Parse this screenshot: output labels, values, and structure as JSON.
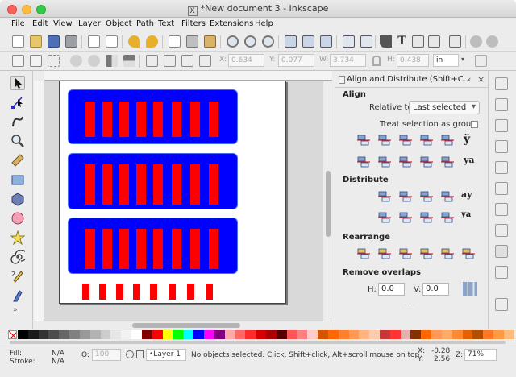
{
  "window": {
    "title": "*New document 3 - Inkscape",
    "app_glyph": "X"
  },
  "menu": [
    "File",
    "Edit",
    "View",
    "Layer",
    "Object",
    "Path",
    "Text",
    "Filters",
    "Extensions",
    "Help"
  ],
  "toolbar2": {
    "x_label": "X:",
    "x_value": "0.634",
    "y_label": "Y:",
    "y_value": "0.077",
    "w_label": "W:",
    "w_value": "3.734",
    "h_label": "H:",
    "h_value": "0.438",
    "unit": "in"
  },
  "dock": {
    "title": "Align and Distribute (Shift+C...",
    "align_heading": "Align",
    "relative_label": "Relative to:",
    "relative_value": "Last selected",
    "treat_group_label": "Treat selection as group:",
    "distribute_heading": "Distribute",
    "rearrange_heading": "Rearrange",
    "remove_overlaps_heading": "Remove overlaps",
    "h_label": "H:",
    "h_value": "0.0",
    "v_label": "V:",
    "v_value": "0.0"
  },
  "status": {
    "fill_label": "Fill:",
    "fill_value": "N/A",
    "stroke_label": "Stroke:",
    "stroke_value": "N/A",
    "opacity_label": "O:",
    "opacity_value": "100",
    "layer": "•Layer 1",
    "message": "No objects selected. Click, Shift+click, Alt+scroll mouse on top",
    "x_label": "X:",
    "x_value": "-0.28",
    "y_label": "Y:",
    "y_value": "2.56",
    "z_label": "Z:",
    "zoom": "71%"
  },
  "colors": {
    "group_fill": "#0000ff",
    "bar_fill": "#ff0000"
  }
}
